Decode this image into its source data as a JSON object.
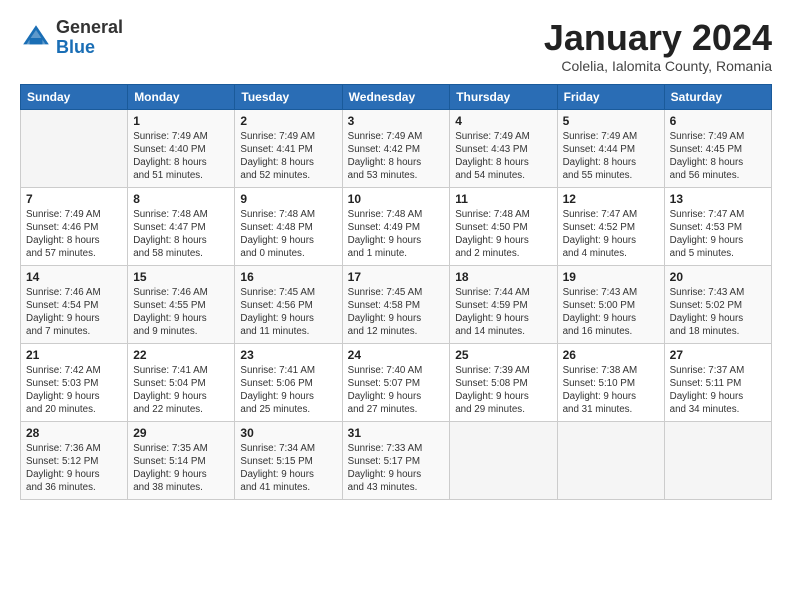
{
  "logo": {
    "general": "General",
    "blue": "Blue"
  },
  "title": "January 2024",
  "location": "Colelia, Ialomita County, Romania",
  "days_header": [
    "Sunday",
    "Monday",
    "Tuesday",
    "Wednesday",
    "Thursday",
    "Friday",
    "Saturday"
  ],
  "weeks": [
    [
      {
        "num": "",
        "info": ""
      },
      {
        "num": "1",
        "info": "Sunrise: 7:49 AM\nSunset: 4:40 PM\nDaylight: 8 hours\nand 51 minutes."
      },
      {
        "num": "2",
        "info": "Sunrise: 7:49 AM\nSunset: 4:41 PM\nDaylight: 8 hours\nand 52 minutes."
      },
      {
        "num": "3",
        "info": "Sunrise: 7:49 AM\nSunset: 4:42 PM\nDaylight: 8 hours\nand 53 minutes."
      },
      {
        "num": "4",
        "info": "Sunrise: 7:49 AM\nSunset: 4:43 PM\nDaylight: 8 hours\nand 54 minutes."
      },
      {
        "num": "5",
        "info": "Sunrise: 7:49 AM\nSunset: 4:44 PM\nDaylight: 8 hours\nand 55 minutes."
      },
      {
        "num": "6",
        "info": "Sunrise: 7:49 AM\nSunset: 4:45 PM\nDaylight: 8 hours\nand 56 minutes."
      }
    ],
    [
      {
        "num": "7",
        "info": "Sunrise: 7:49 AM\nSunset: 4:46 PM\nDaylight: 8 hours\nand 57 minutes."
      },
      {
        "num": "8",
        "info": "Sunrise: 7:48 AM\nSunset: 4:47 PM\nDaylight: 8 hours\nand 58 minutes."
      },
      {
        "num": "9",
        "info": "Sunrise: 7:48 AM\nSunset: 4:48 PM\nDaylight: 9 hours\nand 0 minutes."
      },
      {
        "num": "10",
        "info": "Sunrise: 7:48 AM\nSunset: 4:49 PM\nDaylight: 9 hours\nand 1 minute."
      },
      {
        "num": "11",
        "info": "Sunrise: 7:48 AM\nSunset: 4:50 PM\nDaylight: 9 hours\nand 2 minutes."
      },
      {
        "num": "12",
        "info": "Sunrise: 7:47 AM\nSunset: 4:52 PM\nDaylight: 9 hours\nand 4 minutes."
      },
      {
        "num": "13",
        "info": "Sunrise: 7:47 AM\nSunset: 4:53 PM\nDaylight: 9 hours\nand 5 minutes."
      }
    ],
    [
      {
        "num": "14",
        "info": "Sunrise: 7:46 AM\nSunset: 4:54 PM\nDaylight: 9 hours\nand 7 minutes."
      },
      {
        "num": "15",
        "info": "Sunrise: 7:46 AM\nSunset: 4:55 PM\nDaylight: 9 hours\nand 9 minutes."
      },
      {
        "num": "16",
        "info": "Sunrise: 7:45 AM\nSunset: 4:56 PM\nDaylight: 9 hours\nand 11 minutes."
      },
      {
        "num": "17",
        "info": "Sunrise: 7:45 AM\nSunset: 4:58 PM\nDaylight: 9 hours\nand 12 minutes."
      },
      {
        "num": "18",
        "info": "Sunrise: 7:44 AM\nSunset: 4:59 PM\nDaylight: 9 hours\nand 14 minutes."
      },
      {
        "num": "19",
        "info": "Sunrise: 7:43 AM\nSunset: 5:00 PM\nDaylight: 9 hours\nand 16 minutes."
      },
      {
        "num": "20",
        "info": "Sunrise: 7:43 AM\nSunset: 5:02 PM\nDaylight: 9 hours\nand 18 minutes."
      }
    ],
    [
      {
        "num": "21",
        "info": "Sunrise: 7:42 AM\nSunset: 5:03 PM\nDaylight: 9 hours\nand 20 minutes."
      },
      {
        "num": "22",
        "info": "Sunrise: 7:41 AM\nSunset: 5:04 PM\nDaylight: 9 hours\nand 22 minutes."
      },
      {
        "num": "23",
        "info": "Sunrise: 7:41 AM\nSunset: 5:06 PM\nDaylight: 9 hours\nand 25 minutes."
      },
      {
        "num": "24",
        "info": "Sunrise: 7:40 AM\nSunset: 5:07 PM\nDaylight: 9 hours\nand 27 minutes."
      },
      {
        "num": "25",
        "info": "Sunrise: 7:39 AM\nSunset: 5:08 PM\nDaylight: 9 hours\nand 29 minutes."
      },
      {
        "num": "26",
        "info": "Sunrise: 7:38 AM\nSunset: 5:10 PM\nDaylight: 9 hours\nand 31 minutes."
      },
      {
        "num": "27",
        "info": "Sunrise: 7:37 AM\nSunset: 5:11 PM\nDaylight: 9 hours\nand 34 minutes."
      }
    ],
    [
      {
        "num": "28",
        "info": "Sunrise: 7:36 AM\nSunset: 5:12 PM\nDaylight: 9 hours\nand 36 minutes."
      },
      {
        "num": "29",
        "info": "Sunrise: 7:35 AM\nSunset: 5:14 PM\nDaylight: 9 hours\nand 38 minutes."
      },
      {
        "num": "30",
        "info": "Sunrise: 7:34 AM\nSunset: 5:15 PM\nDaylight: 9 hours\nand 41 minutes."
      },
      {
        "num": "31",
        "info": "Sunrise: 7:33 AM\nSunset: 5:17 PM\nDaylight: 9 hours\nand 43 minutes."
      },
      {
        "num": "",
        "info": ""
      },
      {
        "num": "",
        "info": ""
      },
      {
        "num": "",
        "info": ""
      }
    ]
  ]
}
